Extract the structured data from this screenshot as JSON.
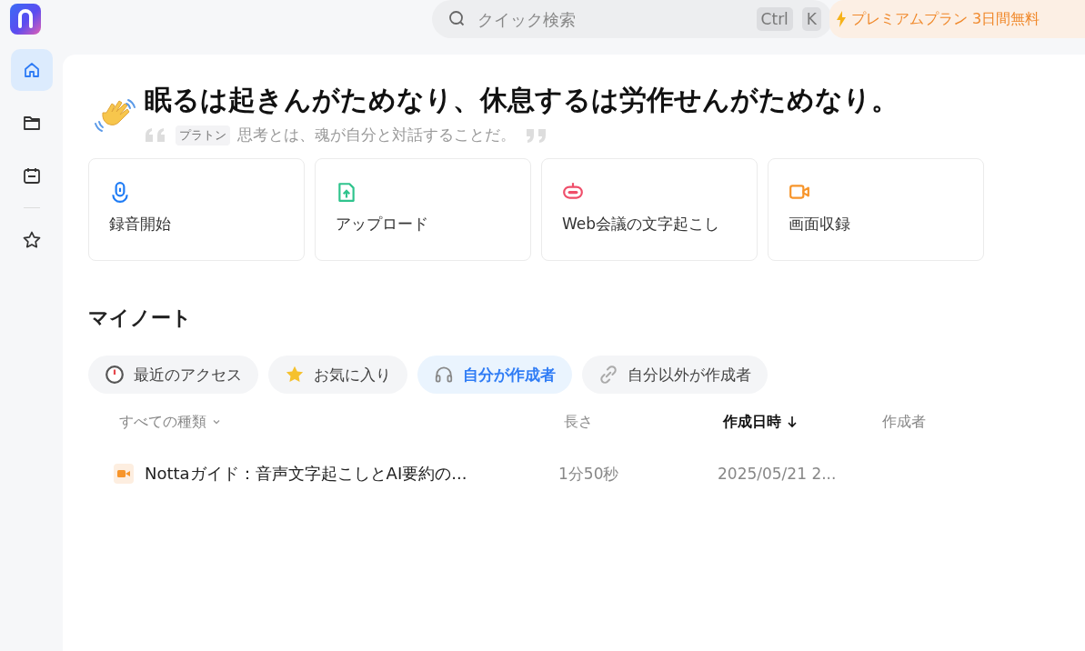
{
  "search": {
    "placeholder": "クイック検索",
    "keys": [
      "Ctrl",
      "K"
    ]
  },
  "promo": {
    "label": "プレミアムプラン 3日間無料"
  },
  "sidebar": {
    "items": [
      {
        "kind": "home",
        "selected": true
      },
      {
        "kind": "folder",
        "selected": false
      },
      {
        "kind": "calendar",
        "selected": false
      },
      {
        "kind": "divider"
      },
      {
        "kind": "star",
        "selected": false
      }
    ]
  },
  "greeting": {
    "title": "眠るは起きんがためなり、休息するは労作せんがためなり。",
    "author": "プラトン",
    "quote": "思考とは、魂が自分と対話することだ。"
  },
  "actions": [
    {
      "kind": "record",
      "label": "録音開始"
    },
    {
      "kind": "upload",
      "label": "アップロード"
    },
    {
      "kind": "meeting",
      "label": "Web会議の文字起こし"
    },
    {
      "kind": "screen",
      "label": "画面収録"
    }
  ],
  "notes": {
    "title": "マイノート",
    "filters": [
      {
        "kind": "recent",
        "label": "最近のアクセス",
        "selected": false
      },
      {
        "kind": "favorite",
        "label": "お気に入り",
        "selected": false
      },
      {
        "kind": "mine",
        "label": "自分が作成者",
        "selected": true
      },
      {
        "kind": "others",
        "label": "自分以外が作成者",
        "selected": false
      }
    ],
    "columns": [
      {
        "label": "すべての種類",
        "kind": "dropdown"
      },
      {
        "label": "長さ",
        "kind": "plain",
        "sorted": false
      },
      {
        "label": "作成日時",
        "kind": "plain",
        "sorted": true
      },
      {
        "label": "作成者",
        "kind": "plain",
        "sorted": false
      }
    ],
    "rows": [
      {
        "title": "Nottaガイド：音声文字起こしとAI要約の...",
        "duration": "1分50秒",
        "created": "2025/05/21 2..."
      }
    ]
  }
}
